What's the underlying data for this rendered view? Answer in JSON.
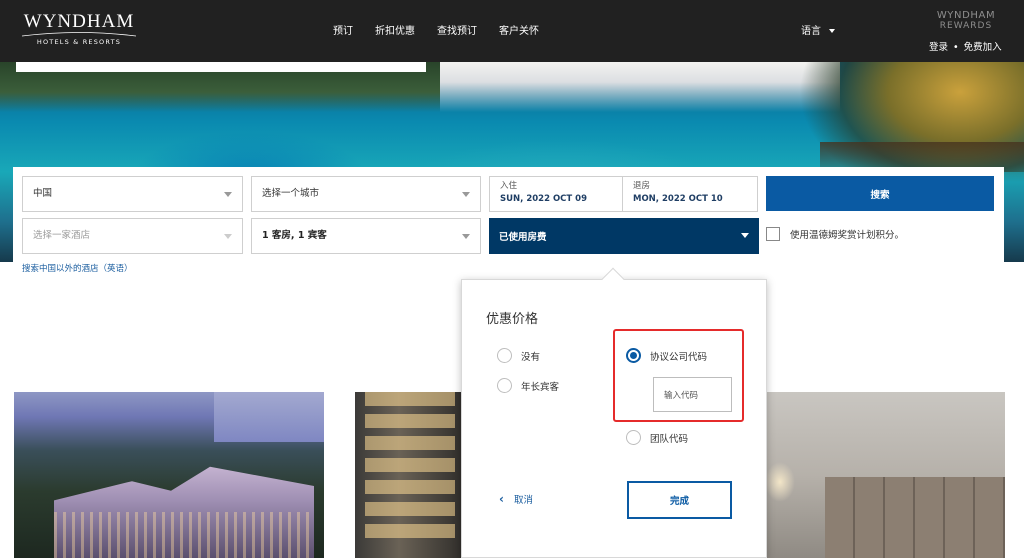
{
  "header": {
    "logo_main": "WYNDHAM",
    "logo_sub": "HOTELS & RESORTS",
    "nav": [
      "预订",
      "折扣优惠",
      "查找预订",
      "客户关怀"
    ],
    "language": "语言",
    "rewards_line1": "WYNDHAM",
    "rewards_line2": "REWARDS",
    "login": "登录",
    "separator": "•",
    "join": "免费加入"
  },
  "booking": {
    "country": "中国",
    "city_placeholder": "选择一个城市",
    "checkin_label": "入住",
    "checkin_value": "SUN, 2022 OCT 09",
    "checkout_label": "退房",
    "checkout_value": "MON, 2022 OCT 10",
    "search_button": "搜索",
    "hotel_placeholder": "选择一家酒店",
    "rooms_guests": "1 客房, 1 宾客",
    "rate_field": "已使用房费",
    "points_label": "使用温德姆奖赏计划积分。",
    "outside_link": "搜索中国以外的酒店（英语）"
  },
  "rate_popup": {
    "title": "优惠价格",
    "options": {
      "none": "没有",
      "senior": "年长宾客",
      "corporate": "协议公司代码",
      "group": "团队代码"
    },
    "selected": "corporate",
    "code_placeholder": "输入代码",
    "cancel": "取消",
    "done": "完成"
  },
  "colors": {
    "header_bg": "#212121",
    "primary_blue": "#0a5aa3",
    "navy": "#003865",
    "highlight_red": "#e52b2b"
  }
}
